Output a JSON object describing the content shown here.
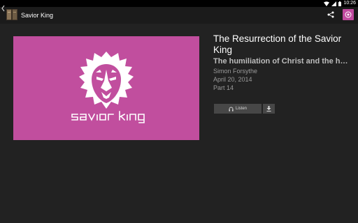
{
  "status_bar": {
    "time": "10:26"
  },
  "action_bar": {
    "title": "Savior King"
  },
  "hero": {
    "logo_text": "savior king",
    "background": "#c14e9e"
  },
  "episode": {
    "title": "The Resurrection of the Savior King",
    "subtitle": "The humiliation of Christ and the horror of the cross",
    "author": "Simon Forsythe",
    "date": "April 20, 2014",
    "part": "Part 14"
  },
  "actions": {
    "listen_label": "Listen"
  },
  "icons": [
    "wifi-icon",
    "signal-icon",
    "battery-icon",
    "back-chevron-icon",
    "share-icon",
    "menu-icon",
    "headphones-icon",
    "download-icon",
    "lion-icon"
  ],
  "colors": {
    "accent": "#c04a9f",
    "background": "#222222",
    "button": "#474747"
  }
}
